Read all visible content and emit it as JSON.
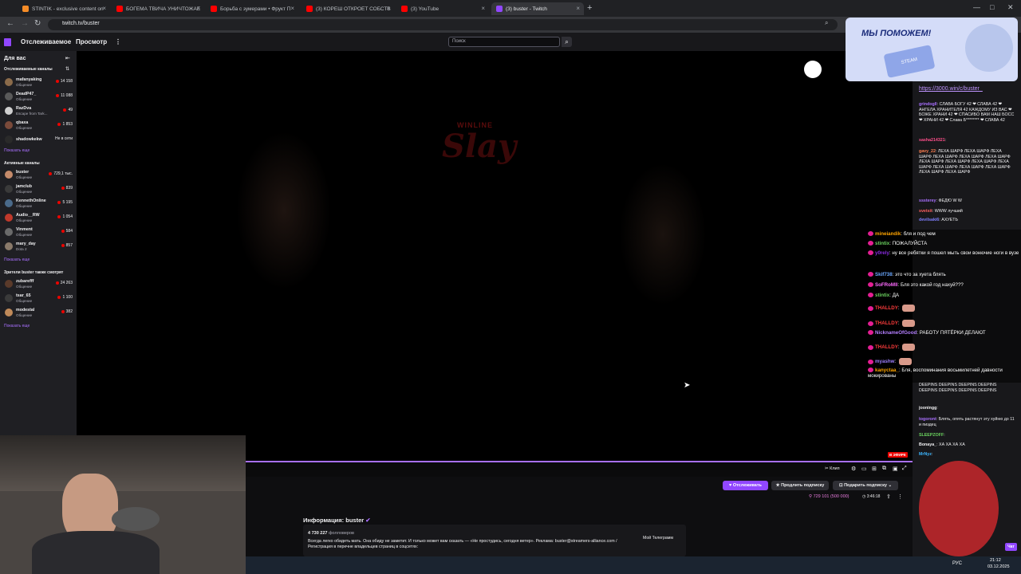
{
  "browser": {
    "tabs": [
      {
        "title": "STINTIK - exclusive content on",
        "color": "#f58c27"
      },
      {
        "title": "БОГЕМА ТВИЧА УНИЧТОЖАЕ",
        "color": "#ff0000"
      },
      {
        "title": "Борьба с зумерами • Фрукт П",
        "color": "#ff0000"
      },
      {
        "title": "(3) КОРЕШ ОТКРОЕТ СОБСТВ",
        "color": "#ff0000"
      },
      {
        "title": "(3) YouTube",
        "color": "#ff0000"
      },
      {
        "title": "(3) buster - Twitch",
        "color": "#9147ff"
      }
    ],
    "url": "twitch.tv/buster"
  },
  "topnav": {
    "following": "Отслеживаемое",
    "browse": "Просмотр",
    "search_placeholder": "Поиск"
  },
  "sidebar": {
    "for_you": "Для вас",
    "followed_title": "Отслеживаемые каналы",
    "followed": [
      {
        "name": "mafanyaking",
        "sub": "Общение",
        "count": "14 158",
        "color": "#8b6b4a"
      },
      {
        "name": "DeadP47_",
        "sub": "Общение",
        "count": "11 088",
        "color": "#5a5a5a"
      },
      {
        "name": "RazDva",
        "sub": "Escape from Tark...",
        "count": "49",
        "color": "#d0d0d0"
      },
      {
        "name": "qbaxa",
        "sub": "Общение",
        "count": "1 853",
        "color": "#7a4a3a"
      },
      {
        "name": "shadowkekw",
        "sub": "",
        "count": "Не в сети",
        "color": "#2a2a2a"
      }
    ],
    "show_more_1": "Показать еще",
    "active_title": "Активные каналы",
    "active": [
      {
        "name": "buster",
        "sub": "Общение",
        "count": "729,1 тыс.",
        "color": "#c48a6a"
      },
      {
        "name": "jamclub",
        "sub": "Общение",
        "count": "839",
        "color": "#3a3a3a"
      },
      {
        "name": "KennethOnline",
        "sub": "Общение",
        "count": "5 195",
        "color": "#4a6a8a"
      },
      {
        "name": "Audio__RW",
        "sub": "Общение",
        "count": "1 054",
        "color": "#c0392b"
      },
      {
        "name": "Vinment",
        "sub": "Общение",
        "count": "584",
        "color": "#6a6a6a"
      },
      {
        "name": "mary_day",
        "sub": "Dota 2",
        "count": "857",
        "color": "#8a7a6a"
      }
    ],
    "show_more_2": "Показать еще",
    "also_watch_title": "Зрители buster также смотрят",
    "also_watch": [
      {
        "name": "zubarefff",
        "sub": "Общение",
        "count": "24 263",
        "color": "#5a3a2a"
      },
      {
        "name": "tsar_65",
        "sub": "Общение",
        "count": "1 100",
        "color": "#3a3a3a"
      },
      {
        "name": "modestal",
        "sub": "Общение",
        "count": "382",
        "color": "#c08a5a"
      }
    ],
    "show_more_3": "Показать еще"
  },
  "video": {
    "overlay_brand": "WINLINE",
    "overlay_word": "Slay",
    "live_badge": "В ЭФИРЕ",
    "clip_label": "Клип"
  },
  "channel": {
    "follow_button": "Отслеживать",
    "subscribe_button": "Продлить подписку",
    "gift_button": "Подарить подписку",
    "viewers": "729 101 (500 000)",
    "uptime": "3:46:18",
    "about_label": "Информация: buster",
    "followers": "4 730 227",
    "followers_label": "фолловеров",
    "description": "Всегда легко обидеть мать. Она обиду не заметит. И только может вам сказать — «Не простудись, сегодня ветер». Реклама: buster@streamers-alliance.com / Регистрация в перечне владельцев страниц в соцсетях:",
    "telegram": "Мой Телеграмм"
  },
  "ad": {
    "headline": "МЫ ПОМОЖЕМ!",
    "badge": "STEAM"
  },
  "chat": {
    "link_text": "https://3000.win/c/buster_",
    "messages": [
      {
        "user": "grindogll",
        "color": "#a970ff",
        "text": "СЛАВА БОГУ 42 ❤ СЛАВА 42 ❤ АНГЕЛА ХРАНИТЕЛЯ 42 КАЖДОМУ ИЗ ВАС ❤ БОЖЕ ХРАНИ 42 ❤ СПАСИБО ВАМ НАШ БОСС ❤ ХРАНИ 42 ❤ Слава Б******** ❤ СЛАВА 42"
      },
      {
        "user": "sasha214321",
        "color": "#ff4f8b",
        "text": ""
      },
      {
        "user": "gavy_22",
        "color": "#ff7f50",
        "text": "ЛЕХА ШАРФ ЛЕХА ШАРФ ЛЕХА ШАРФ ЛЕХА ШАРФ ЛЕХА ШАРФ ЛЕХА ШАРФ ЛЕХА ШАРФ ЛЕХА ШАРФ ЛЕХА ШАРФ ЛЕХА ШАРФ ЛЕХА ШАРФ ЛЕХА ШАРФ ЛЕХА ШАРФ ЛЕХА ШАРФ ЛЕХА ШАРФ"
      },
      {
        "user": "sssterey",
        "color": "#a970ff",
        "text": "ФЕДЮ W W"
      },
      {
        "user": "svetsit",
        "color": "#ff6060",
        "text": "WWW лучший"
      },
      {
        "user": "devilsaki6",
        "color": "#7f7fff",
        "text": "АХУЕТЬ"
      },
      {
        "user": "",
        "color": "#efeff1",
        "text": "DEEPINS DEEPINS DEEPINS DEEPINS DEEPINS DEEPINS DEEPINS DEEPINS"
      },
      {
        "user": "jooningg",
        "color": "#efeff1",
        "text": ""
      },
      {
        "user": "togoront",
        "color": "#a970ff",
        "text": "Блять, опять растянут эту хуйню до 11 и пиздец"
      },
      {
        "user": "SLEEPZOFF",
        "color": "#6bd25f",
        "text": ""
      },
      {
        "user": "Bonaya_",
        "color": "#efeff1",
        "text": "ХА ХА ХА ХА"
      },
      {
        "user": "MrNyz",
        "color": "#3cb6ff",
        "text": ""
      }
    ],
    "chat_button": "Чат"
  },
  "overlay_chat": [
    {
      "user": "mineiandik",
      "color": "#ffa500",
      "text": "бля и под чем"
    },
    {
      "user": "stintix",
      "color": "#6bd25f",
      "text": "ПОЖАЛУЙСТА"
    },
    {
      "user": "y0rely",
      "color": "#8a2be2",
      "text": "ну все ребятки я пошел мыть свои вонючие ноги в вузе"
    },
    {
      "user": "Skif738",
      "color": "#6ba8ff",
      "text": "это что за хуета блять"
    },
    {
      "user": "SoFRoMll",
      "color": "#ff6bff",
      "text": "Бля это какой год нахуй???"
    },
    {
      "user": "stintix",
      "color": "#6bd25f",
      "text": "ДА"
    },
    {
      "user": "THALLDY",
      "color": "#ff3c3c",
      "text": ""
    },
    {
      "user": "THALLDY",
      "color": "#ff3c3c",
      "text": ""
    },
    {
      "user": "NicknameOfGood",
      "color": "#b47fff",
      "text": "РАБОТУ ПЯТЁРКИ ДЕЛАЮТ"
    },
    {
      "user": "THALLDY",
      "color": "#ff3c3c",
      "text": ""
    },
    {
      "user": "myashw",
      "color": "#9f7fff",
      "text": ""
    },
    {
      "user": "kanyctaa_",
      "color": "#ffa500",
      "text": "Бля, воспоминания восьмилетней давности мокированы"
    }
  ],
  "taskbar": {
    "lang": "РУС",
    "time": "21:12",
    "date": "03.12.2025"
  }
}
